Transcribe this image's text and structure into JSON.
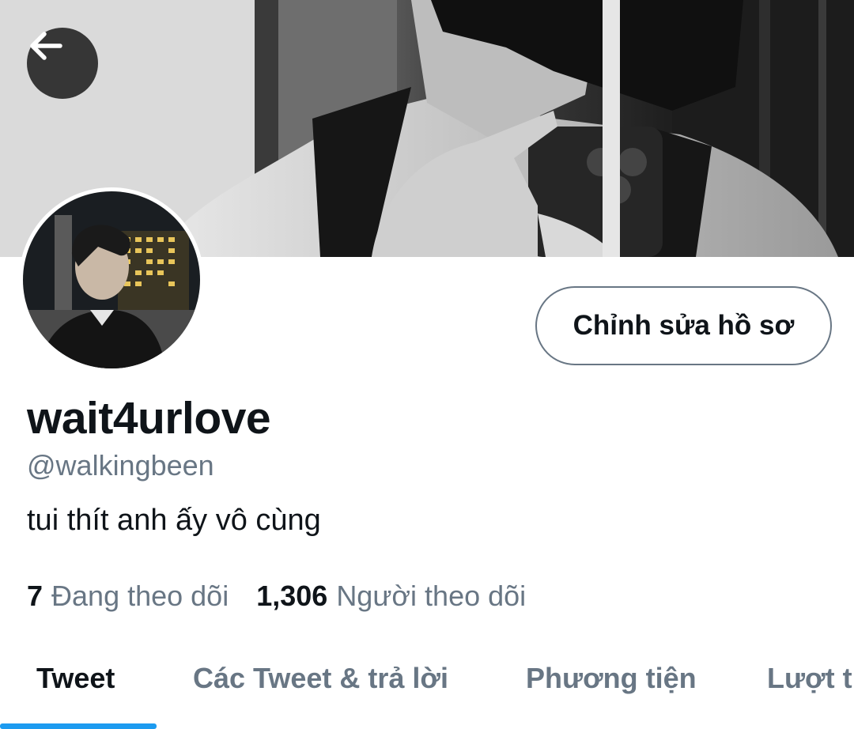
{
  "header": {
    "back_icon": "arrow-left-icon",
    "banner_description_icon": "banner-photo"
  },
  "profile": {
    "edit_button_label": "Chỉnh sửa hồ sơ",
    "display_name": "wait4urlove",
    "handle": "@walkingbeen",
    "bio": "tui thít anh ấy vô cùng"
  },
  "stats": {
    "following_count": "7",
    "following_label": "Đang theo dõi",
    "followers_count": "1,306",
    "followers_label": "Người theo dõi"
  },
  "tabs": [
    {
      "label": "Tweet",
      "active": true
    },
    {
      "label": "Các Tweet & trả lời",
      "active": false
    },
    {
      "label": "Phương tiện",
      "active": false
    },
    {
      "label": "Lượt thích",
      "active": false
    }
  ],
  "colors": {
    "text_primary": "#0f1419",
    "text_secondary": "#687684",
    "accent": "#1d9bf0"
  }
}
